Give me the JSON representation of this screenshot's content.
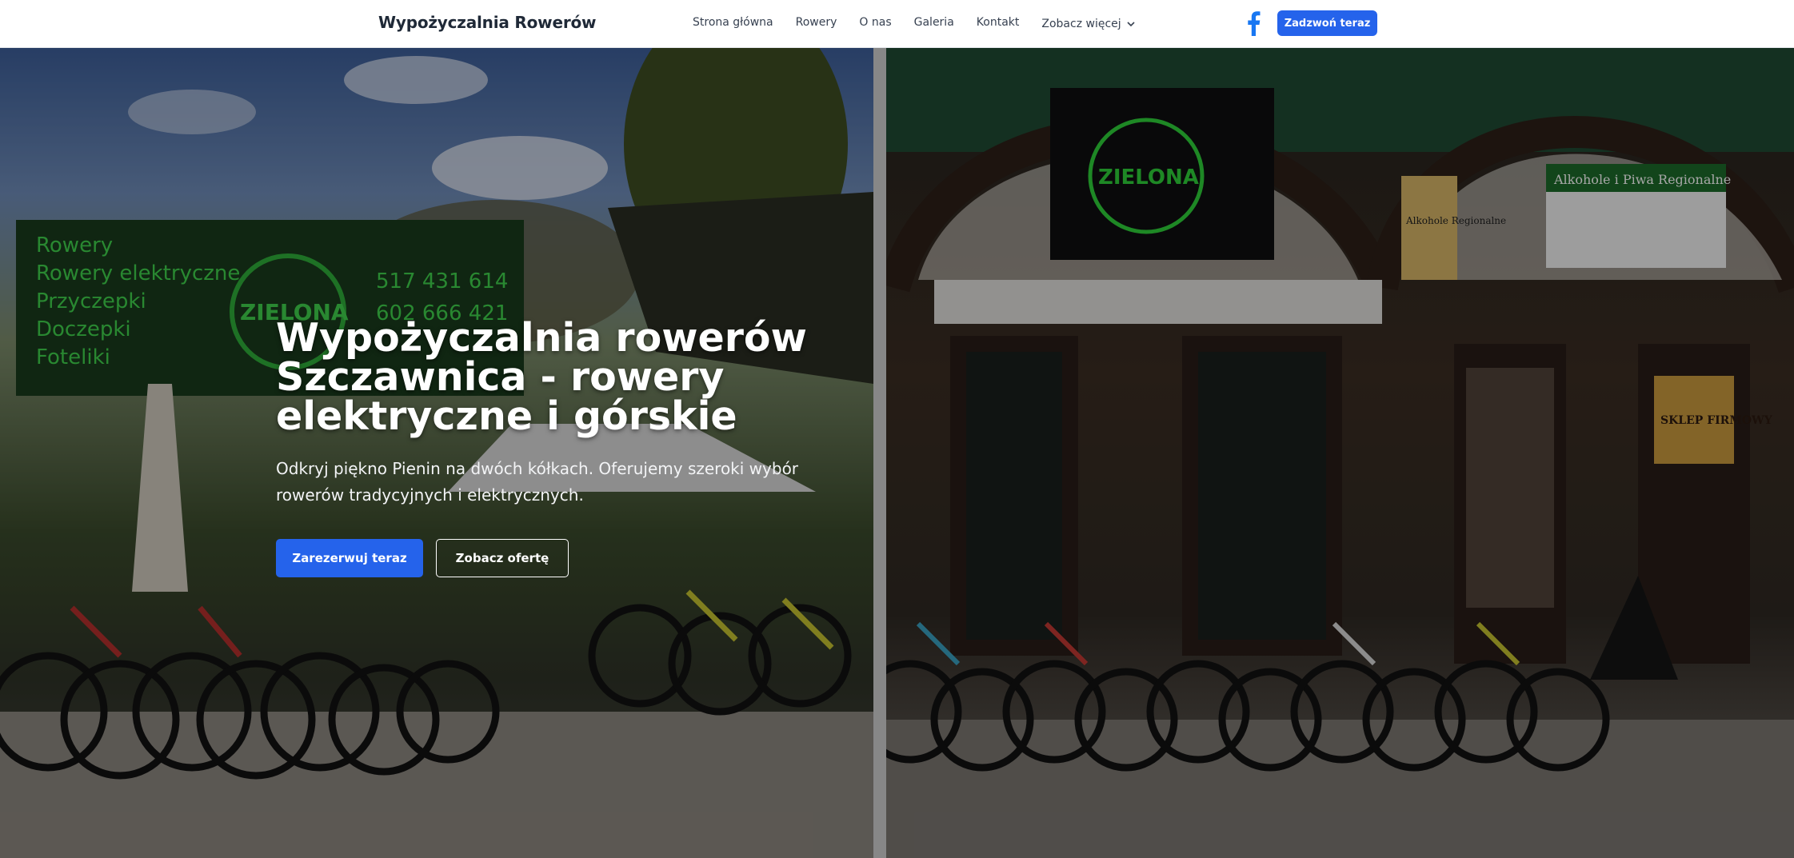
{
  "header": {
    "brand": "Wypożyczalnia Rowerów",
    "nav": [
      "Strona główna",
      "Rowery",
      "O nas",
      "Galeria",
      "Kontakt"
    ],
    "more_label": "Zobacz więcej",
    "call_button": "Zadzwoń teraz",
    "facebook_icon": "facebook-icon",
    "accent_color": "#2563eb"
  },
  "hero": {
    "title": "Wypożyczalnia rowerów Szczawnica - rowery elektryczne i górskie",
    "subtitle": "Odkryj piękno Pienin na dwóch kółkach. Oferujemy szeroki wybór rowerów tradycyjnych i elektrycznych.",
    "primary_button": "Zarezerwuj teraz",
    "secondary_button": "Zobacz ofertę",
    "left_sign": {
      "lines": [
        "Rowery",
        "Rowery elektryczne",
        "Przyczepki",
        "Doczepki",
        "Foteliki"
      ],
      "phones": [
        "517 431 614",
        "602 666 421"
      ],
      "logo": "ZIELONA"
    },
    "right_signs": {
      "alcohol_top": "Alkohole i Piwa Regionalne",
      "alcohol_side": "Alkohole Regionalne",
      "shop": "SKLEP FIRMOWY",
      "logo": "ZIELONA"
    }
  }
}
